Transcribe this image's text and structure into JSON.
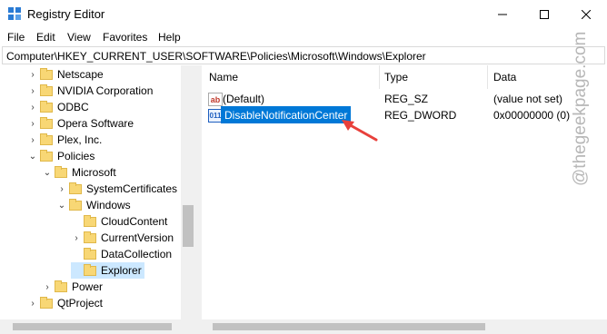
{
  "window": {
    "title": "Registry Editor",
    "controls": {
      "minimize": "—",
      "maximize": "☐",
      "close": "✕"
    }
  },
  "menu": [
    "File",
    "Edit",
    "View",
    "Favorites",
    "Help"
  ],
  "address": "Computer\\HKEY_CURRENT_USER\\SOFTWARE\\Policies\\Microsoft\\Windows\\Explorer",
  "tree": [
    {
      "label": "Netscape",
      "chevron": "›"
    },
    {
      "label": "NVIDIA Corporation",
      "chevron": "›"
    },
    {
      "label": "ODBC",
      "chevron": "›"
    },
    {
      "label": "Opera Software",
      "chevron": "›"
    },
    {
      "label": "Plex, Inc.",
      "chevron": "›"
    },
    {
      "label": "Policies",
      "chevron": "⌄"
    },
    {
      "label": "Microsoft",
      "chevron": "⌄"
    },
    {
      "label": "SystemCertificates",
      "chevron": "›"
    },
    {
      "label": "Windows",
      "chevron": "⌄"
    },
    {
      "label": "CloudContent",
      "chevron": ""
    },
    {
      "label": "CurrentVersion",
      "chevron": "›"
    },
    {
      "label": "DataCollection",
      "chevron": ""
    },
    {
      "label": "Explorer",
      "chevron": "",
      "selected": true
    },
    {
      "label": "Power",
      "chevron": "›"
    },
    {
      "label": "QtProject",
      "chevron": "›"
    }
  ],
  "columns": {
    "name": "Name",
    "type": "Type",
    "data": "Data"
  },
  "values": [
    {
      "name": "(Default)",
      "type": "REG_SZ",
      "data": "(value not set)",
      "icon": "ab"
    },
    {
      "name": "DisableNotificationCenter",
      "type": "REG_DWORD",
      "data": "0x00000000 (0)",
      "icon": "011"
    }
  ],
  "watermark": "@thegeekpage.com",
  "colors": {
    "selection": "#cce8ff",
    "edit_highlight": "#0078d7",
    "arrow": "#e8403b"
  }
}
